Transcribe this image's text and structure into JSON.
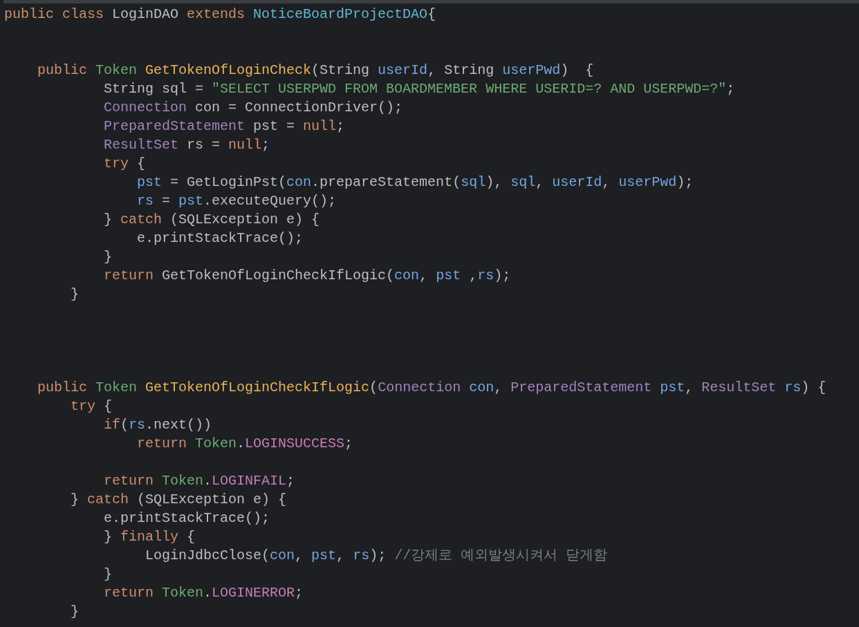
{
  "editor": {
    "lines": [
      {
        "kind": "code",
        "tokens": [
          {
            "kind": "kw",
            "text": "public class "
          },
          {
            "kind": "plain",
            "text": "LoginDAO "
          },
          {
            "kind": "kw",
            "text": "extends "
          },
          {
            "kind": "cls",
            "text": "NoticeBoardProjectDAO"
          },
          {
            "kind": "plain",
            "text": "{"
          }
        ]
      },
      {
        "kind": "blank"
      },
      {
        "kind": "blank"
      },
      {
        "kind": "code",
        "tokens": [
          {
            "kind": "kw",
            "text": "    public "
          },
          {
            "kind": "type",
            "text": "Token "
          },
          {
            "kind": "decl",
            "text": "GetTokenOfLoginCheck"
          },
          {
            "kind": "plain",
            "text": "(String "
          },
          {
            "kind": "var",
            "text": "userId"
          },
          {
            "kind": "plain",
            "text": ", String "
          },
          {
            "kind": "var",
            "text": "userPwd"
          },
          {
            "kind": "plain",
            "text": ")  {"
          }
        ]
      },
      {
        "kind": "code",
        "tokens": [
          {
            "kind": "plain",
            "text": "            String sql = "
          },
          {
            "kind": "str",
            "text": "\"SELECT USERPWD FROM BOARDMEMBER WHERE USERID=? AND USERPWD=?\""
          },
          {
            "kind": "plain",
            "text": ";"
          }
        ]
      },
      {
        "kind": "code",
        "tokens": [
          {
            "kind": "iface",
            "text": "            Connection "
          },
          {
            "kind": "plain",
            "text": "con = ConnectionDriver();"
          }
        ]
      },
      {
        "kind": "code",
        "tokens": [
          {
            "kind": "iface",
            "text": "            PreparedStatement "
          },
          {
            "kind": "plain",
            "text": "pst = "
          },
          {
            "kind": "kw",
            "text": "null"
          },
          {
            "kind": "plain",
            "text": ";"
          }
        ]
      },
      {
        "kind": "code",
        "tokens": [
          {
            "kind": "iface",
            "text": "            ResultSet "
          },
          {
            "kind": "plain",
            "text": "rs = "
          },
          {
            "kind": "kw",
            "text": "null"
          },
          {
            "kind": "plain",
            "text": ";"
          }
        ]
      },
      {
        "kind": "code",
        "tokens": [
          {
            "kind": "kw",
            "text": "            try "
          },
          {
            "kind": "plain",
            "text": "{"
          }
        ]
      },
      {
        "kind": "code",
        "tokens": [
          {
            "kind": "var",
            "text": "                pst"
          },
          {
            "kind": "plain",
            "text": " = GetLoginPst("
          },
          {
            "kind": "var",
            "text": "con"
          },
          {
            "kind": "plain",
            "text": ".prepareStatement("
          },
          {
            "kind": "var",
            "text": "sql"
          },
          {
            "kind": "plain",
            "text": "), "
          },
          {
            "kind": "var",
            "text": "sql"
          },
          {
            "kind": "plain",
            "text": ", "
          },
          {
            "kind": "var",
            "text": "userId"
          },
          {
            "kind": "plain",
            "text": ", "
          },
          {
            "kind": "var",
            "text": "userPwd"
          },
          {
            "kind": "plain",
            "text": ");"
          }
        ]
      },
      {
        "kind": "code",
        "tokens": [
          {
            "kind": "var",
            "text": "                rs"
          },
          {
            "kind": "plain",
            "text": " = "
          },
          {
            "kind": "var",
            "text": "pst"
          },
          {
            "kind": "plain",
            "text": ".executeQuery();"
          }
        ]
      },
      {
        "kind": "code",
        "tokens": [
          {
            "kind": "plain",
            "text": "            } "
          },
          {
            "kind": "kw",
            "text": "catch "
          },
          {
            "kind": "plain",
            "text": "(SQLException e) {"
          }
        ]
      },
      {
        "kind": "code",
        "tokens": [
          {
            "kind": "plain",
            "text": "                e.printStackTrace();"
          }
        ]
      },
      {
        "kind": "code",
        "tokens": [
          {
            "kind": "plain",
            "text": "            }"
          }
        ]
      },
      {
        "kind": "code",
        "tokens": [
          {
            "kind": "kw",
            "text": "            return "
          },
          {
            "kind": "plain",
            "text": "GetTokenOfLoginCheckIfLogic("
          },
          {
            "kind": "var",
            "text": "con"
          },
          {
            "kind": "plain",
            "text": ", "
          },
          {
            "kind": "var",
            "text": "pst"
          },
          {
            "kind": "plain",
            "text": " ,"
          },
          {
            "kind": "var",
            "text": "rs"
          },
          {
            "kind": "plain",
            "text": ");"
          }
        ]
      },
      {
        "kind": "code",
        "tokens": [
          {
            "kind": "plain",
            "text": "        }"
          }
        ]
      },
      {
        "kind": "blank"
      },
      {
        "kind": "blank"
      },
      {
        "kind": "blank"
      },
      {
        "kind": "blank"
      },
      {
        "kind": "code",
        "tokens": [
          {
            "kind": "kw",
            "text": "    public "
          },
          {
            "kind": "type",
            "text": "Token "
          },
          {
            "kind": "decl",
            "text": "GetTokenOfLoginCheckIfLogic"
          },
          {
            "kind": "plain",
            "text": "("
          },
          {
            "kind": "iface",
            "text": "Connection "
          },
          {
            "kind": "var",
            "text": "con"
          },
          {
            "kind": "plain",
            "text": ", "
          },
          {
            "kind": "iface",
            "text": "PreparedStatement "
          },
          {
            "kind": "var",
            "text": "pst"
          },
          {
            "kind": "plain",
            "text": ", "
          },
          {
            "kind": "iface",
            "text": "ResultSet "
          },
          {
            "kind": "var",
            "text": "rs"
          },
          {
            "kind": "plain",
            "text": ") {"
          }
        ]
      },
      {
        "kind": "code",
        "tokens": [
          {
            "kind": "kw",
            "text": "        try "
          },
          {
            "kind": "plain",
            "text": "{"
          }
        ]
      },
      {
        "kind": "code",
        "tokens": [
          {
            "kind": "kw",
            "text": "            if"
          },
          {
            "kind": "plain",
            "text": "("
          },
          {
            "kind": "var",
            "text": "rs"
          },
          {
            "kind": "plain",
            "text": ".next())"
          }
        ]
      },
      {
        "kind": "code",
        "tokens": [
          {
            "kind": "kw",
            "text": "                return "
          },
          {
            "kind": "type",
            "text": "Token"
          },
          {
            "kind": "plain",
            "text": "."
          },
          {
            "kind": "const",
            "text": "LOGINSUCCESS"
          },
          {
            "kind": "plain",
            "text": ";"
          }
        ]
      },
      {
        "kind": "blank"
      },
      {
        "kind": "code",
        "tokens": [
          {
            "kind": "kw",
            "text": "            return "
          },
          {
            "kind": "type",
            "text": "Token"
          },
          {
            "kind": "plain",
            "text": "."
          },
          {
            "kind": "const",
            "text": "LOGINFAIL"
          },
          {
            "kind": "plain",
            "text": ";"
          }
        ]
      },
      {
        "kind": "code",
        "tokens": [
          {
            "kind": "plain",
            "text": "        } "
          },
          {
            "kind": "kw",
            "text": "catch "
          },
          {
            "kind": "plain",
            "text": "(SQLException e) {"
          }
        ]
      },
      {
        "kind": "code",
        "tokens": [
          {
            "kind": "plain",
            "text": "            e.printStackTrace();"
          }
        ]
      },
      {
        "kind": "code",
        "tokens": [
          {
            "kind": "plain",
            "text": "            } "
          },
          {
            "kind": "kw",
            "text": "finally "
          },
          {
            "kind": "plain",
            "text": "{"
          }
        ]
      },
      {
        "kind": "code",
        "tokens": [
          {
            "kind": "plain",
            "text": "                 LoginJdbcClose("
          },
          {
            "kind": "var",
            "text": "con"
          },
          {
            "kind": "plain",
            "text": ", "
          },
          {
            "kind": "var",
            "text": "pst"
          },
          {
            "kind": "plain",
            "text": ", "
          },
          {
            "kind": "var",
            "text": "rs"
          },
          {
            "kind": "plain",
            "text": "); "
          },
          {
            "kind": "comment",
            "text": "//강제로 예외발생시켜서 닫게함"
          }
        ]
      },
      {
        "kind": "code",
        "tokens": [
          {
            "kind": "plain",
            "text": "            }"
          }
        ]
      },
      {
        "kind": "code",
        "tokens": [
          {
            "kind": "kw",
            "text": "            return "
          },
          {
            "kind": "type",
            "text": "Token"
          },
          {
            "kind": "plain",
            "text": "."
          },
          {
            "kind": "const",
            "text": "LOGINERROR"
          },
          {
            "kind": "plain",
            "text": ";"
          }
        ]
      },
      {
        "kind": "code",
        "tokens": [
          {
            "kind": "plain",
            "text": "        }"
          }
        ]
      }
    ]
  }
}
